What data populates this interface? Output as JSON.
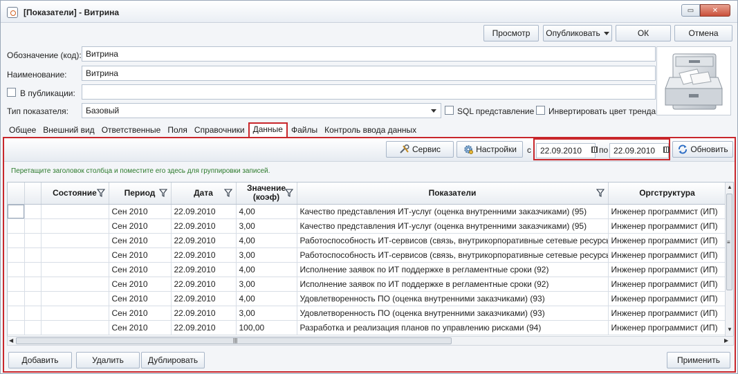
{
  "window": {
    "title": "[Показатели] - Витрина",
    "controls": {
      "minimize": "▭",
      "close": "✕"
    }
  },
  "actions": {
    "preview": "Просмотр",
    "publish": "Опубликовать",
    "ok": "ОК",
    "cancel": "Отмена"
  },
  "form": {
    "code_label": "Обозначение (код):",
    "code_value": "Витрина",
    "name_label": "Наименование:",
    "name_value": "Витрина",
    "publication_label": "В публикации:",
    "publication_checked": false,
    "publication_value": "",
    "type_label": "Тип показателя:",
    "type_value": "Базовый",
    "sql_label": "SQL представление",
    "sql_checked": false,
    "invert_label": "Инвертировать цвет тренда",
    "invert_checked": false
  },
  "tabs": [
    {
      "label": "Общее",
      "active": false
    },
    {
      "label": "Внешний вид",
      "active": false
    },
    {
      "label": "Ответственные",
      "active": false
    },
    {
      "label": "Поля",
      "active": false
    },
    {
      "label": "Справочники",
      "active": false
    },
    {
      "label": "Данные",
      "active": true
    },
    {
      "label": "Файлы",
      "active": false
    },
    {
      "label": "Контроль ввода данных",
      "active": false
    }
  ],
  "data_toolbar": {
    "service": "Сервис",
    "settings": "Настройки",
    "from_label": "с",
    "from_date": "22.09.2010",
    "to_label": "по",
    "to_date": "22.09.2010",
    "refresh": "Обновить"
  },
  "group_hint": "Перетащите заголовок столбца и поместите его здесь для группировки записей.",
  "grid": {
    "columns": [
      "Состояние",
      "Период",
      "Дата",
      "Значение (коэф)",
      "Показатели",
      "Оргструктура"
    ],
    "rows": [
      [
        "",
        "Сен 2010",
        "22.09.2010",
        "4,00",
        "Качество представления ИТ-услуг (оценка внутренними заказчиками) (95)",
        "Инженер программист (ИП)"
      ],
      [
        "",
        "Сен 2010",
        "22.09.2010",
        "3,00",
        "Качество представления ИТ-услуг (оценка внутренними заказчиками) (95)",
        "Инженер программист (ИП)"
      ],
      [
        "",
        "Сен 2010",
        "22.09.2010",
        "4,00",
        "Работоспособность ИТ-сервисов (связь, внутрикорпоративные сетевые ресурсы",
        "Инженер программист (ИП)"
      ],
      [
        "",
        "Сен 2010",
        "22.09.2010",
        "3,00",
        "Работоспособность ИТ-сервисов (связь, внутрикорпоративные сетевые ресурсы",
        "Инженер программист (ИП)"
      ],
      [
        "",
        "Сен 2010",
        "22.09.2010",
        "4,00",
        "Исполнение заявок по ИТ поддержке в регламентные сроки (92)",
        "Инженер программист (ИП)"
      ],
      [
        "",
        "Сен 2010",
        "22.09.2010",
        "3,00",
        "Исполнение заявок по ИТ поддержке в регламентные сроки (92)",
        "Инженер программист (ИП)"
      ],
      [
        "",
        "Сен 2010",
        "22.09.2010",
        "4,00",
        "Удовлетворенность ПО (оценка внутренними заказчиками) (93)",
        "Инженер программист (ИП)"
      ],
      [
        "",
        "Сен 2010",
        "22.09.2010",
        "3,00",
        "Удовлетворенность ПО (оценка внутренними заказчиками) (93)",
        "Инженер программист (ИП)"
      ],
      [
        "",
        "Сен 2010",
        "22.09.2010",
        "100,00",
        "Разработка и реализация планов по управлению рисками (94)",
        "Инженер программист (ИП)"
      ]
    ]
  },
  "bottom": {
    "add": "Добавить",
    "delete": "Удалить",
    "duplicate": "Дублировать",
    "apply": "Применить"
  },
  "colors": {
    "highlight": "#c8262b",
    "hint_text": "#2c7a2c"
  }
}
